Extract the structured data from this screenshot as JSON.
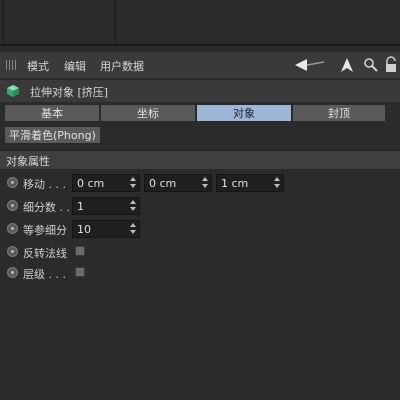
{
  "menu": {
    "modes": "模式",
    "edit": "编辑",
    "user_data": "用户数据"
  },
  "toolbar_icons": [
    "back-arrow-icon",
    "cursor-icon",
    "search-icon",
    "lock-icon"
  ],
  "object": {
    "title": "拉伸对象 [挤压]",
    "icon": "extrude-cube-icon"
  },
  "tabs": [
    {
      "label": "基本",
      "active": false
    },
    {
      "label": "坐标",
      "active": false
    },
    {
      "label": "对象",
      "active": true
    },
    {
      "label": "封顶",
      "active": false
    }
  ],
  "subtab": {
    "label": "平滑着色(Phong)"
  },
  "section": {
    "title": "对象属性"
  },
  "properties": {
    "move": {
      "label": "移动 . . .",
      "x": "0 cm",
      "y": "0 cm",
      "z": "1 cm"
    },
    "subdivision": {
      "label": "细分数 . .",
      "value": "1"
    },
    "isoparm": {
      "label": "等参细分",
      "value": "10"
    },
    "flip_normals": {
      "label": "反转法线",
      "checked": false
    },
    "hierarchical": {
      "label": "层级 . . .",
      "checked": false
    }
  },
  "colors": {
    "active_tab": "#9db5d6",
    "background": "#2b2b2b",
    "field": "#1f1f1f"
  }
}
